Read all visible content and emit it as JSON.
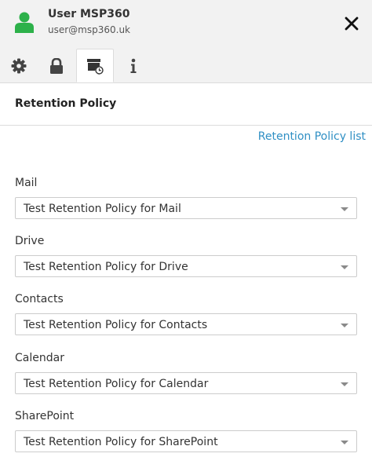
{
  "user": {
    "name": "User MSP360",
    "email": "user@msp360.uk"
  },
  "header": {
    "close_icon": "close-icon",
    "avatar_icon": "user-avatar-icon",
    "avatar_color": "#2db14a"
  },
  "tabs": [
    {
      "icon": "gear-icon",
      "active": false
    },
    {
      "icon": "lock-icon",
      "active": false
    },
    {
      "icon": "archive-clock-icon",
      "active": true
    },
    {
      "icon": "info-icon",
      "active": false
    }
  ],
  "section": {
    "title": "Retention Policy",
    "link_label": "Retention Policy list",
    "link_color": "#2f8fc4"
  },
  "fields": [
    {
      "label": "Mail",
      "value": "Test Retention Policy for Mail"
    },
    {
      "label": "Drive",
      "value": "Test Retention Policy for Drive"
    },
    {
      "label": "Contacts",
      "value": "Test Retention Policy for Contacts"
    },
    {
      "label": "Calendar",
      "value": "Test Retention Policy for Calendar"
    },
    {
      "label": "SharePoint",
      "value": "Test Retention Policy for SharePoint"
    }
  ]
}
